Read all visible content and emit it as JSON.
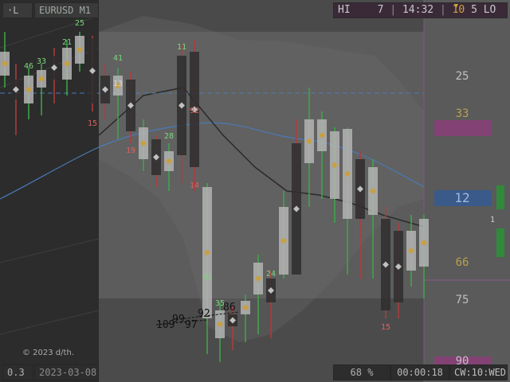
{
  "header": {
    "mode_label": "·L",
    "symbol_timeframe": "EURUSD M1",
    "hi_label": "HI",
    "hi_value": "7",
    "time": "14:32",
    "marker_value": "10",
    "lo_value": "5",
    "lo_label": "LO"
  },
  "footer": {
    "left_value": "0.3",
    "date": "2023-03-08",
    "zoom": "68 %",
    "elapsed": "00:00:18",
    "cw_label": "CW:10:WED"
  },
  "watermark": "© 2023 d/th.",
  "right_scale": {
    "levels": [
      "25",
      "33",
      "12",
      "66",
      "75",
      "90"
    ],
    "side_marker": "1",
    "current_level": "12"
  },
  "chart_data": {
    "type": "candlestick",
    "volume_labels": [
      {
        "text": "25",
        "color": "#7bd67b"
      },
      {
        "text": "21",
        "color": "#7bd67b"
      },
      {
        "text": "46",
        "color": "#7bd67b"
      },
      {
        "text": "33",
        "color": "#7bd67b"
      },
      {
        "text": "41",
        "color": "#7bd67b"
      },
      {
        "text": "13",
        "color": "#d8d8d8"
      },
      {
        "text": "15",
        "color": "#e06060"
      },
      {
        "text": "19",
        "color": "#e06060"
      },
      {
        "text": "28",
        "color": "#7bd67b"
      },
      {
        "text": "11",
        "color": "#7bd67b"
      },
      {
        "text": "92",
        "color": "#e06060"
      },
      {
        "text": "14",
        "color": "#e06060"
      },
      {
        "text": "91",
        "color": "#7bd67b"
      },
      {
        "text": "24",
        "color": "#7bd67b"
      },
      {
        "text": "35",
        "color": "#7bd67b"
      },
      {
        "text": "15",
        "color": "#e06060"
      }
    ],
    "overlay_numbers": [
      "86",
      "92",
      "99",
      "109",
      "97"
    ]
  },
  "colors": {
    "panel_dark": "#2b2b2b",
    "bull": "#3ea84a",
    "bear": "#b03c3c",
    "marker_gold": "#c8a040",
    "ma_line": "#4a7ab8",
    "level_pink": "#a04e8a",
    "level_blue": "#3a5a8a"
  }
}
